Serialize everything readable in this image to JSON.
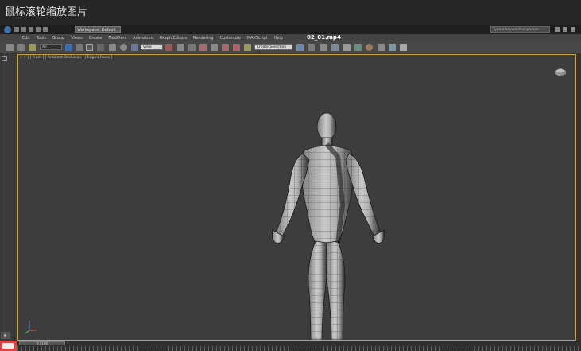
{
  "overlay": {
    "title": "鼠标滚轮缩放图片"
  },
  "video": {
    "filename": "02_01.mp4"
  },
  "app": {
    "workspace": "Workspace: Default",
    "search_placeholder": "Type a keyword or phrase"
  },
  "menu": {
    "items": [
      "Edit",
      "Tools",
      "Group",
      "Views",
      "Create",
      "Modifiers",
      "Animation",
      "Graph Editors",
      "Rendering",
      "Customize",
      "MAXScript",
      "Help"
    ]
  },
  "toolbar": {
    "selection_filter": "All",
    "reference_coord": "View",
    "named_selection": "Create Selection Se"
  },
  "viewport": {
    "label": "[ + ] [ Front ] [ Ambient Occlusion ] [ Edged Faces ]"
  },
  "timeline": {
    "frame_indicator": "0 / 100"
  },
  "colors": {
    "viewport_border": "#c7a64a",
    "accent_blue": "#3b6fb0"
  }
}
